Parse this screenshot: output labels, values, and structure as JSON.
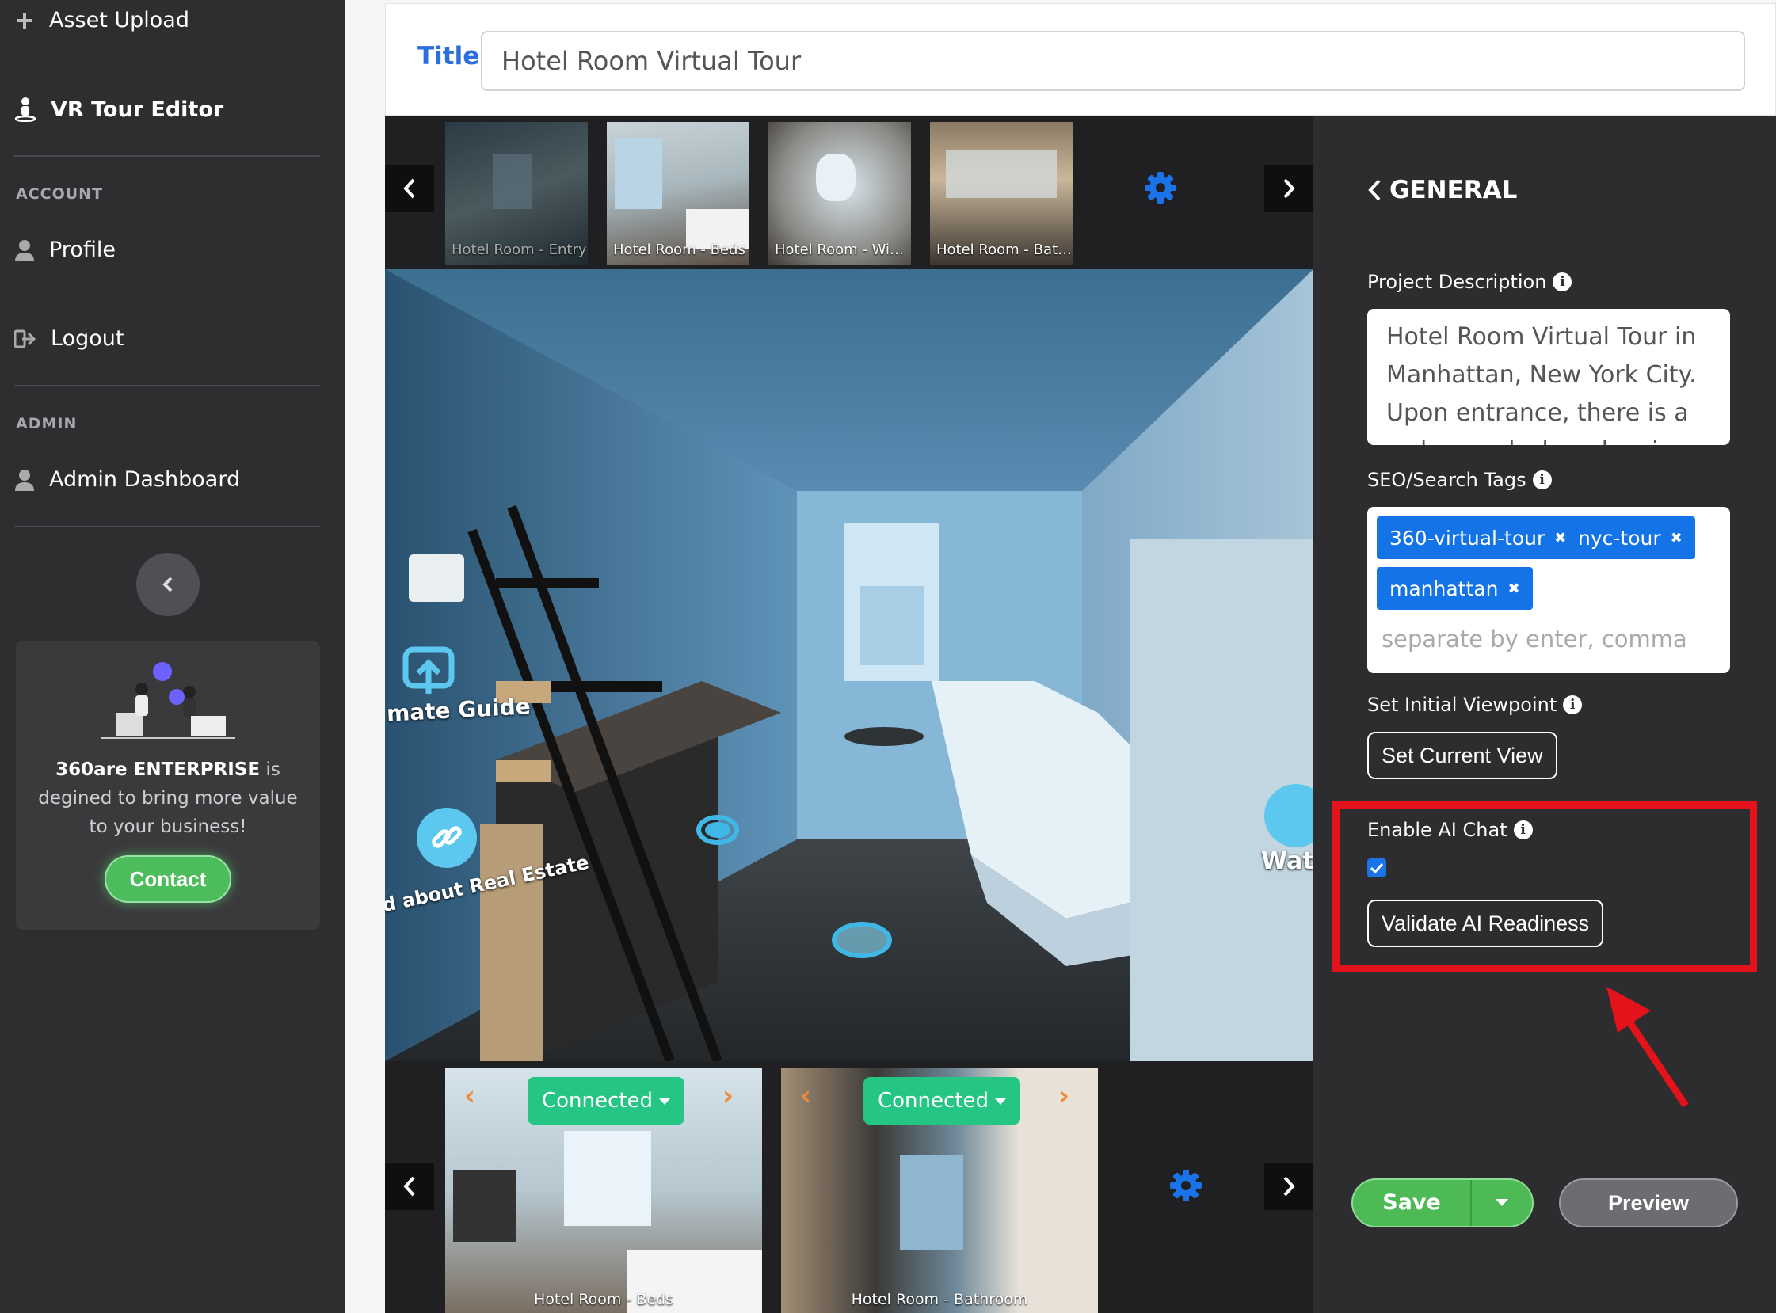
{
  "sidebar": {
    "asset_upload": "Asset Upload",
    "vr_tour_editor": "VR Tour Editor",
    "account_section": "ACCOUNT",
    "profile": "Profile",
    "logout": "Logout",
    "admin_section": "ADMIN",
    "admin_dashboard": "Admin Dashboard",
    "promo": {
      "brand": "360are ENTERPRISE",
      "text_1": "is degined to bring more value to your business!",
      "contact": "Contact"
    }
  },
  "title_bar": {
    "label": "Title",
    "value": "Hotel Room Virtual Tour"
  },
  "top_strip": {
    "thumbs": [
      "Hotel Room - Entry",
      "Hotel Room - Beds",
      "Hotel Room - Win...",
      "Hotel Room - Bath..."
    ]
  },
  "viewer": {
    "hotspot_guide": "mate Guide",
    "hotspot_link": "d about Real Estate",
    "hotspot_watch": "Wat"
  },
  "bottom_strip": {
    "scenes": [
      {
        "caption": "Hotel Room - Beds",
        "status": "Connected"
      },
      {
        "caption": "Hotel Room - Bathroom",
        "status": "Connected"
      }
    ]
  },
  "panel": {
    "header": "GENERAL",
    "desc_label": "Project Description",
    "desc_value": "Hotel Room Virtual Tour in Manhattan, New York City. Upon entrance, there is a welcome desk and a view of",
    "seo_label": "SEO/Search Tags",
    "tags": [
      "360-virtual-tour",
      "nyc-tour",
      "manhattan"
    ],
    "tag_placeholder": "separate by enter, comma",
    "viewpoint_label": "Set Initial Viewpoint",
    "set_view_btn": "Set Current View",
    "ai_chat_label": "Enable AI Chat",
    "ai_chat_enabled": true,
    "validate_btn": "Validate AI Readiness",
    "save": "Save",
    "preview": "Preview"
  },
  "colors": {
    "accent_blue": "#1473e6",
    "save_green": "#4dba56",
    "connected_green": "#25c583",
    "highlight_red": "#e3121b"
  }
}
